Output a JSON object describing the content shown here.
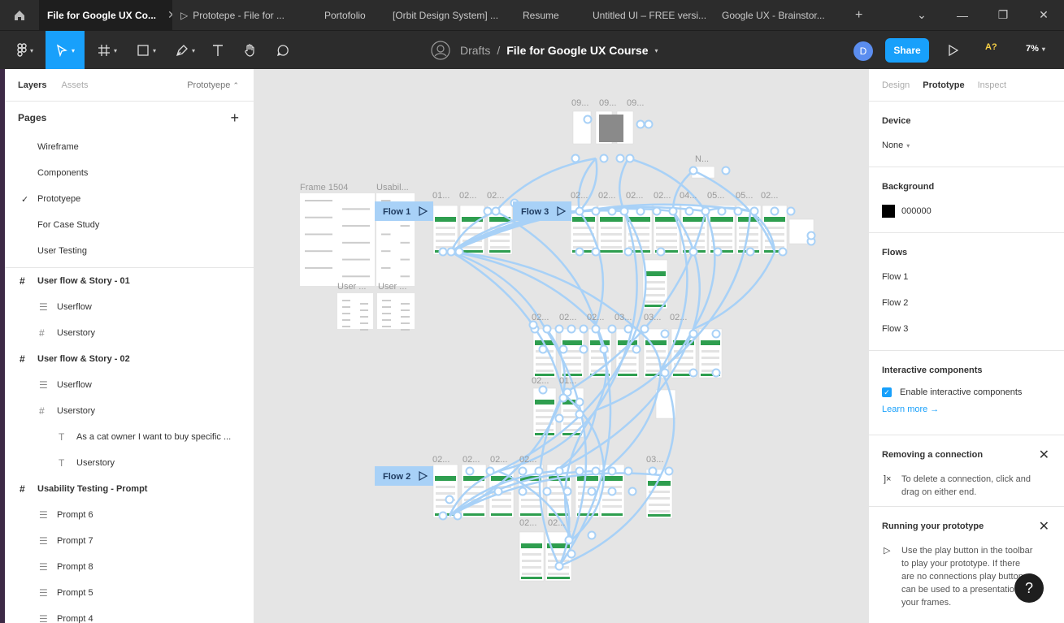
{
  "tabs": [
    {
      "label": "File for Google UX Co...",
      "active": true
    },
    {
      "label": "Prototepe - File for ..."
    },
    {
      "label": "Portofolio"
    },
    {
      "label": "[Orbit Design System] ..."
    },
    {
      "label": "Resume"
    },
    {
      "label": "Untitled UI – FREE versi..."
    },
    {
      "label": "Google UX - Brainstor..."
    }
  ],
  "toolbar": {
    "breadcrumb_root": "Drafts",
    "breadcrumb_sep": "/",
    "file_name": "File for Google UX Course",
    "avatar_letter": "D",
    "share_label": "Share",
    "a11y_label": "A?",
    "zoom": "7%"
  },
  "left_panel": {
    "tab_layers": "Layers",
    "tab_assets": "Assets",
    "page_selector": "Prototyepe",
    "pages_heading": "Pages",
    "pages": [
      "Wireframe",
      "Components",
      "Prototyepe",
      "For Case Study",
      "User Testing"
    ],
    "layers": [
      {
        "label": "User flow & Story - 01",
        "type": "frame",
        "indent": 0
      },
      {
        "label": "Userflow",
        "type": "group",
        "indent": 1
      },
      {
        "label": "Userstory",
        "type": "frame-small",
        "indent": 1
      },
      {
        "label": "User flow & Story - 02",
        "type": "frame",
        "indent": 0
      },
      {
        "label": "Userflow",
        "type": "group",
        "indent": 1
      },
      {
        "label": "Userstory",
        "type": "frame-small",
        "indent": 1
      },
      {
        "label": "As a cat owner I want to buy specific ...",
        "type": "text",
        "indent": 2
      },
      {
        "label": "Userstory",
        "type": "text",
        "indent": 2
      },
      {
        "label": "Usability Testing - Prompt",
        "type": "frame",
        "indent": 0
      },
      {
        "label": "Prompt 6",
        "type": "group",
        "indent": 1
      },
      {
        "label": "Prompt 7",
        "type": "group",
        "indent": 1
      },
      {
        "label": "Prompt 8",
        "type": "group",
        "indent": 1
      },
      {
        "label": "Prompt 5",
        "type": "group",
        "indent": 1
      },
      {
        "label": "Prompt 4",
        "type": "group",
        "indent": 1
      }
    ]
  },
  "canvas": {
    "frame_labels": [
      "Frame 1504",
      "Usabil...",
      "User ...",
      "User ..."
    ],
    "flows": [
      "Flow 1",
      "Flow 3",
      "Flow 2"
    ],
    "screen_labels": [
      "09...",
      "09...",
      "09...",
      "N...",
      "01...",
      "02...",
      "02...",
      "02...",
      "02...",
      "02...",
      "02...",
      "04...",
      "05...",
      "05...",
      "02...",
      "02...",
      "02...",
      "02...",
      "03...",
      "03...",
      "02...",
      "02...",
      "01...",
      "02...",
      "02...",
      "02...",
      "02...",
      "03...",
      "02...",
      "02..."
    ],
    "connector_color": "#a8d1f7",
    "flow_tag_color": "#a8d1f7"
  },
  "right_panel": {
    "tab_design": "Design",
    "tab_prototype": "Prototype",
    "tab_inspect": "Inspect",
    "device_heading": "Device",
    "device_value": "None",
    "background_heading": "Background",
    "background_value": "000000",
    "flows_heading": "Flows",
    "flows": [
      "Flow 1",
      "Flow 2",
      "Flow 3"
    ],
    "interactive_heading": "Interactive components",
    "interactive_checkbox": "Enable interactive components",
    "learn_more": "Learn more →",
    "removing_heading": "Removing a connection",
    "removing_text": "To delete a connection, click and drag on either end.",
    "running_heading": "Running your prototype",
    "running_text": "Use the play button in the toolbar to play your prototype. If there are no connections play button can be used to a presentation of your frames."
  }
}
